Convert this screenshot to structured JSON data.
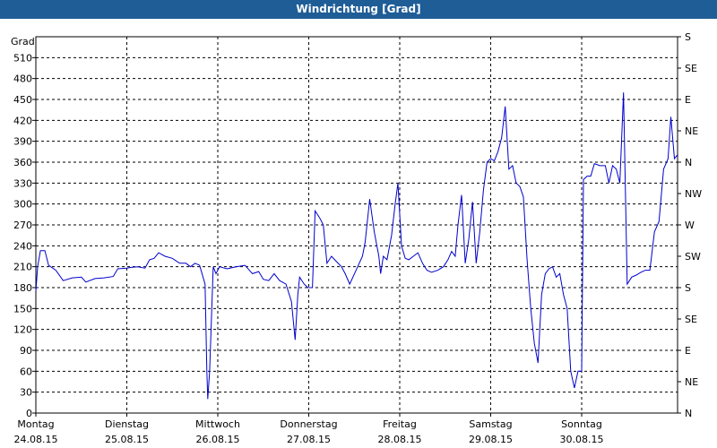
{
  "window": {
    "title": "Windrichtung [Grad]"
  },
  "chart_data": {
    "type": "line",
    "title": "Windrichtung [Grad]",
    "ylabel": "Grad",
    "ylim": [
      0,
      540
    ],
    "yticks": [
      0,
      30,
      60,
      90,
      120,
      150,
      180,
      210,
      240,
      270,
      300,
      330,
      360,
      390,
      420,
      450,
      480,
      510
    ],
    "right_labels": [
      "N",
      "NE",
      "E",
      "SE",
      "S",
      "SW",
      "W",
      "NW",
      "N",
      "NE",
      "E",
      "SE",
      "S"
    ],
    "right_values": [
      0,
      45,
      90,
      135,
      180,
      225,
      270,
      315,
      360,
      405,
      450,
      495,
      540
    ],
    "xlim": [
      0,
      7.1
    ],
    "grid": true,
    "color": "#0000cc",
    "days": [
      {
        "name": "Montag",
        "date": "24.08.15"
      },
      {
        "name": "Dienstag",
        "date": "25.08.15"
      },
      {
        "name": "Mittwoch",
        "date": "26.08.15"
      },
      {
        "name": "Donnerstag",
        "date": "27.08.15"
      },
      {
        "name": "Freitag",
        "date": "28.08.15"
      },
      {
        "name": "Samstag",
        "date": "29.08.15"
      },
      {
        "name": "Sonntag",
        "date": "30.08.15"
      }
    ],
    "series": [
      {
        "points": [
          [
            0.0,
            175
          ],
          [
            0.02,
            210
          ],
          [
            0.05,
            233
          ],
          [
            0.1,
            233
          ],
          [
            0.14,
            212
          ],
          [
            0.22,
            205
          ],
          [
            0.3,
            190
          ],
          [
            0.4,
            194
          ],
          [
            0.5,
            195
          ],
          [
            0.55,
            188
          ],
          [
            0.65,
            193
          ],
          [
            0.75,
            194
          ],
          [
            0.85,
            196
          ],
          [
            0.9,
            207
          ],
          [
            1.0,
            208
          ],
          [
            1.05,
            209
          ],
          [
            1.12,
            210
          ],
          [
            1.2,
            208
          ],
          [
            1.25,
            220
          ],
          [
            1.3,
            222
          ],
          [
            1.35,
            230
          ],
          [
            1.42,
            225
          ],
          [
            1.5,
            222
          ],
          [
            1.58,
            215
          ],
          [
            1.65,
            215
          ],
          [
            1.7,
            210
          ],
          [
            1.75,
            215
          ],
          [
            1.8,
            212
          ],
          [
            1.86,
            185
          ],
          [
            1.88,
            60
          ],
          [
            1.89,
            20
          ],
          [
            1.91,
            60
          ],
          [
            1.95,
            210
          ],
          [
            1.98,
            200
          ],
          [
            2.02,
            210
          ],
          [
            2.1,
            207
          ],
          [
            2.2,
            210
          ],
          [
            2.3,
            212
          ],
          [
            2.38,
            200
          ],
          [
            2.45,
            203
          ],
          [
            2.5,
            192
          ],
          [
            2.56,
            190
          ],
          [
            2.62,
            200
          ],
          [
            2.68,
            190
          ],
          [
            2.75,
            185
          ],
          [
            2.81,
            160
          ],
          [
            2.85,
            105
          ],
          [
            2.88,
            170
          ],
          [
            2.9,
            195
          ],
          [
            2.95,
            185
          ],
          [
            2.99,
            180
          ],
          [
            3.04,
            180
          ],
          [
            3.07,
            290
          ],
          [
            3.12,
            280
          ],
          [
            3.16,
            270
          ],
          [
            3.2,
            215
          ],
          [
            3.25,
            225
          ],
          [
            3.3,
            218
          ],
          [
            3.36,
            210
          ],
          [
            3.4,
            200
          ],
          [
            3.45,
            185
          ],
          [
            3.52,
            205
          ],
          [
            3.59,
            225
          ],
          [
            3.62,
            245
          ],
          [
            3.67,
            307
          ],
          [
            3.72,
            260
          ],
          [
            3.77,
            225
          ],
          [
            3.79,
            200
          ],
          [
            3.82,
            225
          ],
          [
            3.86,
            220
          ],
          [
            3.91,
            255
          ],
          [
            3.95,
            300
          ],
          [
            3.98,
            330
          ],
          [
            4.02,
            240
          ],
          [
            4.06,
            222
          ],
          [
            4.1,
            220
          ],
          [
            4.15,
            225
          ],
          [
            4.2,
            230
          ],
          [
            4.25,
            215
          ],
          [
            4.3,
            205
          ],
          [
            4.35,
            202
          ],
          [
            4.42,
            205
          ],
          [
            4.48,
            210
          ],
          [
            4.53,
            220
          ],
          [
            4.57,
            232
          ],
          [
            4.61,
            225
          ],
          [
            4.64,
            270
          ],
          [
            4.68,
            313
          ],
          [
            4.72,
            215
          ],
          [
            4.76,
            250
          ],
          [
            4.8,
            303
          ],
          [
            4.84,
            215
          ],
          [
            4.88,
            260
          ],
          [
            4.92,
            320
          ],
          [
            4.96,
            360
          ],
          [
            5.0,
            365
          ],
          [
            5.04,
            362
          ],
          [
            5.08,
            375
          ],
          [
            5.12,
            395
          ],
          [
            5.16,
            440
          ],
          [
            5.2,
            350
          ],
          [
            5.24,
            355
          ],
          [
            5.28,
            330
          ],
          [
            5.32,
            325
          ],
          [
            5.36,
            310
          ],
          [
            5.4,
            220
          ],
          [
            5.44,
            150
          ],
          [
            5.48,
            100
          ],
          [
            5.52,
            72
          ],
          [
            5.56,
            170
          ],
          [
            5.6,
            200
          ],
          [
            5.64,
            207
          ],
          [
            5.68,
            210
          ],
          [
            5.72,
            195
          ],
          [
            5.76,
            200
          ],
          [
            5.8,
            170
          ],
          [
            5.84,
            150
          ],
          [
            5.88,
            60
          ],
          [
            5.92,
            36
          ],
          [
            5.96,
            60
          ],
          [
            6.0,
            60
          ],
          [
            6.02,
            335
          ],
          [
            6.06,
            340
          ],
          [
            6.1,
            340
          ],
          [
            6.14,
            358
          ],
          [
            6.2,
            355
          ],
          [
            6.26,
            355
          ],
          [
            6.3,
            330
          ],
          [
            6.34,
            355
          ],
          [
            6.38,
            350
          ],
          [
            6.42,
            330
          ],
          [
            6.46,
            460
          ],
          [
            6.5,
            185
          ],
          [
            6.55,
            195
          ],
          [
            6.6,
            198
          ],
          [
            6.65,
            202
          ],
          [
            6.7,
            205
          ],
          [
            6.75,
            205
          ],
          [
            6.8,
            260
          ],
          [
            6.85,
            275
          ],
          [
            6.9,
            350
          ],
          [
            6.95,
            365
          ],
          [
            6.98,
            425
          ],
          [
            7.02,
            365
          ],
          [
            7.05,
            370
          ]
        ]
      }
    ]
  }
}
